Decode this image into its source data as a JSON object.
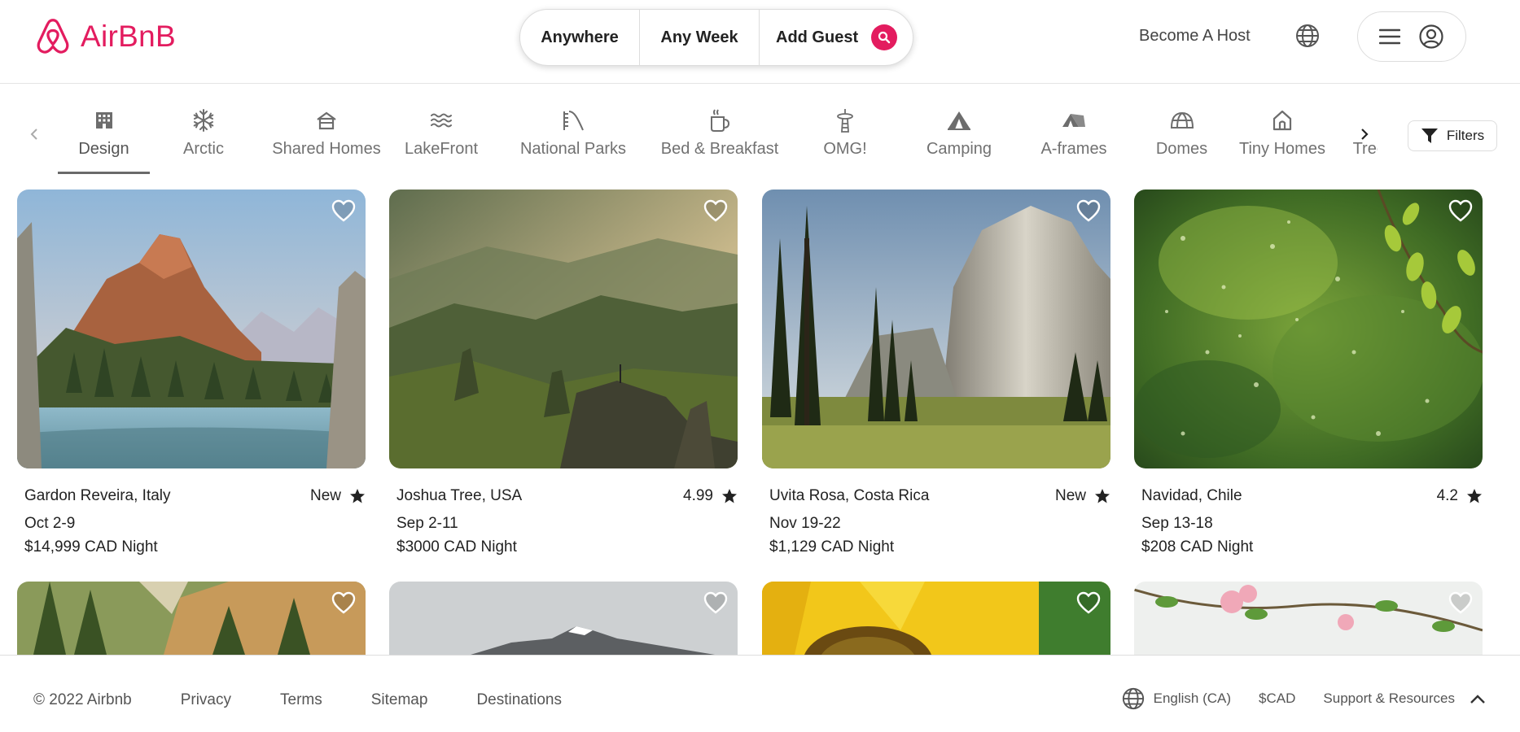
{
  "header": {
    "brand": "AirBnB",
    "search": {
      "where": "Anywhere",
      "when": "Any Week",
      "who": "Add Guest"
    },
    "host_link": "Become A Host"
  },
  "colors": {
    "brand": "#e31c5f",
    "text": "#222222",
    "muted": "#717171"
  },
  "categories": [
    {
      "label": "Design",
      "icon": "building-icon",
      "active": true
    },
    {
      "label": "Arctic",
      "icon": "snowflake-icon"
    },
    {
      "label": "Shared Homes",
      "icon": "shared-home-icon"
    },
    {
      "label": "LakeFront",
      "icon": "waves-icon"
    },
    {
      "label": "National Parks",
      "icon": "park-icon"
    },
    {
      "label": "Bed & Breakfast",
      "icon": "coffee-cup-icon"
    },
    {
      "label": "OMG!",
      "icon": "tower-icon"
    },
    {
      "label": "Camping",
      "icon": "tent-icon"
    },
    {
      "label": "A-frames",
      "icon": "a-frame-icon"
    },
    {
      "label": "Domes",
      "icon": "dome-icon"
    },
    {
      "label": "Tiny Homes",
      "icon": "tiny-home-icon"
    },
    {
      "label": "Treehouses",
      "icon": "treehouse-icon"
    }
  ],
  "filters_label": "Filters",
  "listings": [
    {
      "location": "Gardon Reveira, Italy",
      "rating": "New",
      "dates": "Oct 2-9",
      "price": "$14,999 CAD Night",
      "scene": "mountain-lake"
    },
    {
      "location": "Joshua Tree, USA",
      "rating": "4.99",
      "dates": "Sep 2-11",
      "price": "$3000 CAD Night",
      "scene": "misty-valley"
    },
    {
      "location": "Uvita Rosa, Costa Rica",
      "rating": "New",
      "dates": "Nov 19-22",
      "price": "$1,129 CAD Night",
      "scene": "cliff-meadow"
    },
    {
      "location": "Navidad, Chile",
      "rating": "4.2",
      "dates": "Sep 13-18",
      "price": "$208 CAD Night",
      "scene": "green-bokeh"
    }
  ],
  "footer": {
    "copyright": "© 2022 Airbnb",
    "links": [
      "Privacy",
      "Terms",
      "Sitemap",
      "Destinations"
    ],
    "language": "English (CA)",
    "currency": "$CAD",
    "support": "Support & Resources"
  }
}
